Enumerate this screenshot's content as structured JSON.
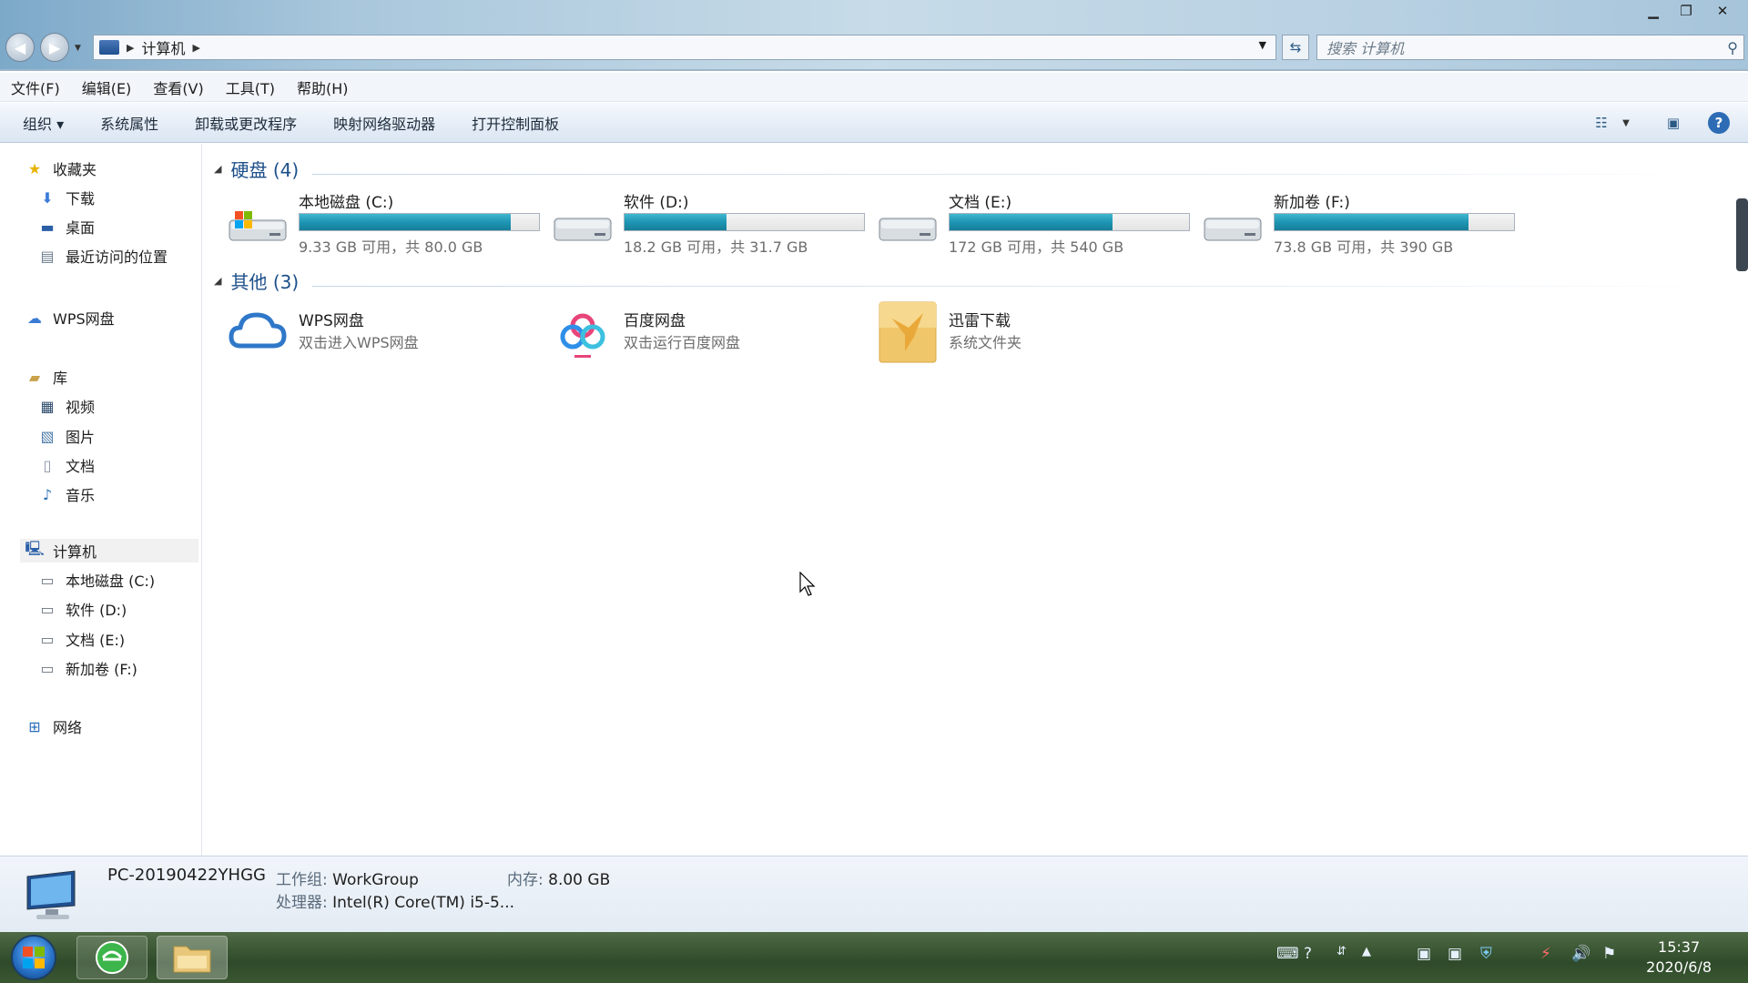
{
  "window": {
    "address": {
      "crumb": "计算机"
    },
    "search": {
      "placeholder": "搜索 计算机"
    }
  },
  "menubar": [
    "文件(F)",
    "编辑(E)",
    "查看(V)",
    "工具(T)",
    "帮助(H)"
  ],
  "toolbar": {
    "organize": "组织 ▾",
    "system_properties": "系统属性",
    "uninstall": "卸载或更改程序",
    "map_drive": "映射网络驱动器",
    "control_panel": "打开控制面板"
  },
  "sidebar": {
    "favorites": "收藏夹",
    "downloads": "下载",
    "desktop": "桌面",
    "recent": "最近访问的位置",
    "wps_drive": "WPS网盘",
    "libraries": "库",
    "videos": "视频",
    "pictures": "图片",
    "documents": "文档",
    "music": "音乐",
    "computer": "计算机",
    "drive_c": "本地磁盘 (C:)",
    "drive_d": "软件 (D:)",
    "drive_e": "文档 (E:)",
    "drive_f": "新加卷 (F:)",
    "network": "网络"
  },
  "groups": {
    "disks": "硬盘 (4)",
    "others": "其他 (3)"
  },
  "drives": [
    {
      "name": "本地磁盘 (C:)",
      "info": "9.33 GB 可用，共 80.0 GB",
      "used_fraction": 0.883
    },
    {
      "name": "软件 (D:)",
      "info": "18.2 GB 可用，共 31.7 GB",
      "used_fraction": 0.426
    },
    {
      "name": "文档 (E:)",
      "info": "172 GB 可用，共 540 GB",
      "used_fraction": 0.681
    },
    {
      "name": "新加卷 (F:)",
      "info": "73.8 GB 可用，共 390 GB",
      "used_fraction": 0.811
    }
  ],
  "others": [
    {
      "name": "WPS网盘",
      "desc": "双击进入WPS网盘"
    },
    {
      "name": "百度网盘",
      "desc": "双击运行百度网盘"
    },
    {
      "name": "迅雷下载",
      "desc": "系统文件夹"
    }
  ],
  "details": {
    "pc_name": "PC-20190422YHGG",
    "workgroup_label": "工作组:",
    "workgroup": "WorkGroup",
    "memory_label": "内存:",
    "memory": "8.00 GB",
    "cpu_label": "处理器:",
    "cpu": "Intel(R) Core(TM) i5-5..."
  },
  "taskbar": {
    "time": "15:37",
    "date": "2020/6/8"
  },
  "colors": {
    "bar_fill": "#1e95b3",
    "group_heading": "#1d4f8a",
    "taskbar": "#3e5a36"
  }
}
